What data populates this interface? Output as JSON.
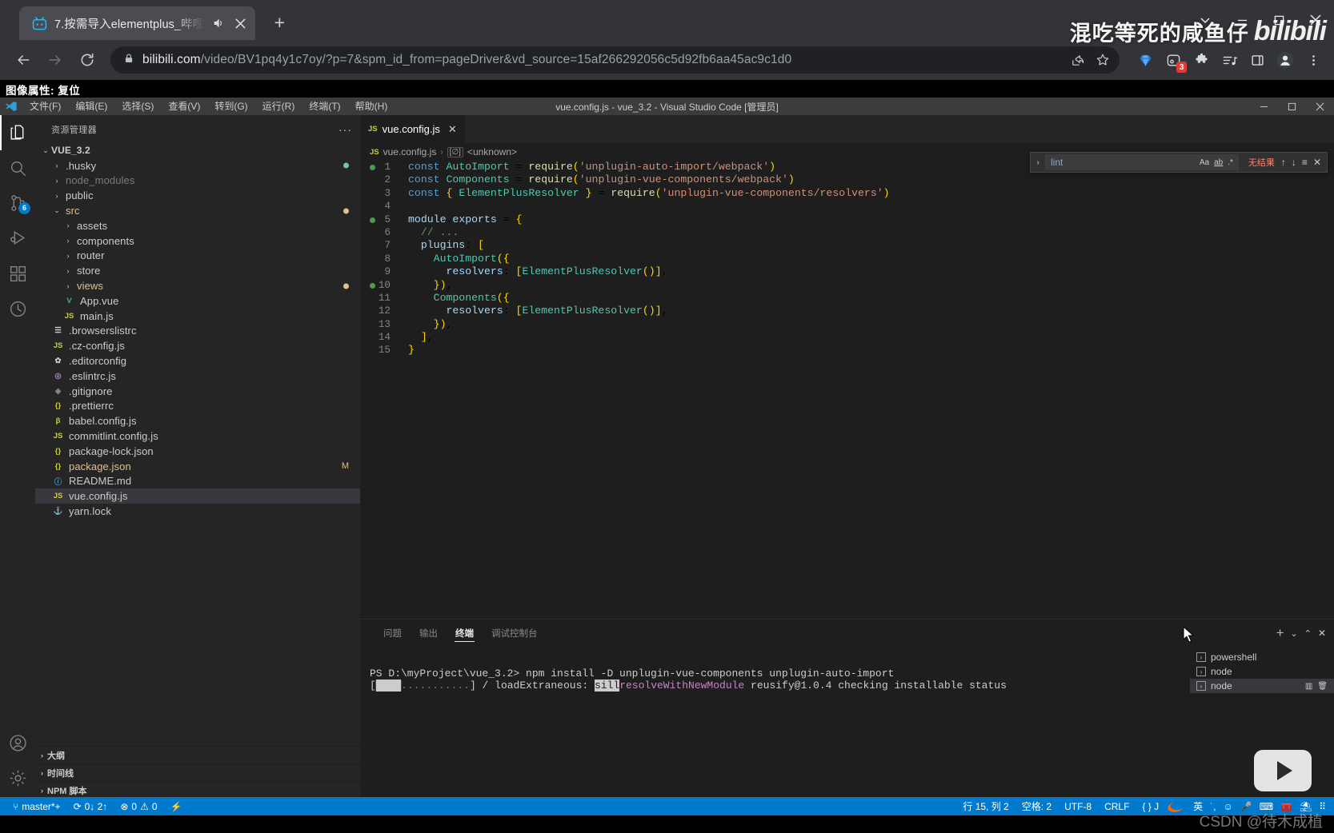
{
  "browser": {
    "tab": {
      "title": "7.按需导入elementplus_哔哩",
      "favicon": "bilibili-icon",
      "audio_icon": "speaker-icon",
      "close_icon": "close-icon"
    },
    "new_tab_label": "+",
    "window_controls": {
      "more": "⌄",
      "minimize": "—",
      "maximize": "▢",
      "close": "✕"
    },
    "nav": {
      "back": "←",
      "forward": "→",
      "reload": "⟳"
    },
    "omnibox": {
      "lock_icon": "lock-icon",
      "host": "bilibili.com",
      "path": "/video/BV1pq4y1c7oy/?p=7&spm_id_from=pageDriver&vd_source=15af266292056c5d92fb6aa45ac9c1d0",
      "share_icon": "share-icon",
      "bookmark_icon": "star-icon"
    },
    "extensions": [
      {
        "name": "diamond-extension-icon",
        "badge": ""
      },
      {
        "name": "tab-group-extension-icon",
        "badge": "3"
      },
      {
        "name": "puzzle-extensions-icon",
        "badge": ""
      },
      {
        "name": "media-playlist-icon",
        "badge": ""
      },
      {
        "name": "side-panel-icon",
        "badge": ""
      },
      {
        "name": "profile-avatar-icon",
        "badge": ""
      },
      {
        "name": "chrome-menu-icon",
        "badge": ""
      }
    ]
  },
  "capture_caption": "图像属性: 复位",
  "vscode": {
    "title": "vue.config.js - vue_3.2 - Visual Studio Code [管理员]",
    "menu": [
      "文件(F)",
      "编辑(E)",
      "选择(S)",
      "查看(V)",
      "转到(G)",
      "运行(R)",
      "终端(T)",
      "帮助(H)"
    ],
    "window_controls": {
      "minimize": "—",
      "maximize": "▢",
      "close": "✕"
    },
    "activitybar": [
      {
        "name": "explorer-icon",
        "badge": "",
        "active": true
      },
      {
        "name": "search-icon",
        "badge": "",
        "active": false
      },
      {
        "name": "source-control-icon",
        "badge": "6",
        "active": false
      },
      {
        "name": "run-debug-icon",
        "badge": "",
        "active": false
      },
      {
        "name": "extensions-icon",
        "badge": "",
        "active": false
      },
      {
        "name": "testing-icon",
        "badge": "",
        "active": false
      }
    ],
    "activitybar_bottom": [
      {
        "name": "accounts-icon"
      },
      {
        "name": "settings-gear-icon"
      }
    ],
    "sidebar": {
      "header": "资源管理器",
      "more_actions": "···",
      "root": {
        "label": "VUE_3.2",
        "expanded": true
      },
      "tree": [
        {
          "label": ".husky",
          "indent": 1,
          "type": "folder",
          "expanded": false,
          "color": "#cccccc",
          "dot": "#73c991"
        },
        {
          "label": "node_modules",
          "indent": 1,
          "type": "folder",
          "expanded": false,
          "color": "#7a7a7a",
          "dot": ""
        },
        {
          "label": "public",
          "indent": 1,
          "type": "folder",
          "expanded": false,
          "color": "#cccccc",
          "dot": ""
        },
        {
          "label": "src",
          "indent": 1,
          "type": "folder",
          "expanded": true,
          "color": "#e2c08d",
          "dot": "#e2c08d"
        },
        {
          "label": "assets",
          "indent": 2,
          "type": "folder",
          "expanded": false,
          "color": "#cccccc",
          "dot": ""
        },
        {
          "label": "components",
          "indent": 2,
          "type": "folder",
          "expanded": false,
          "color": "#cccccc",
          "dot": ""
        },
        {
          "label": "router",
          "indent": 2,
          "type": "folder",
          "expanded": false,
          "color": "#cccccc",
          "dot": ""
        },
        {
          "label": "store",
          "indent": 2,
          "type": "folder",
          "expanded": false,
          "color": "#cccccc",
          "dot": ""
        },
        {
          "label": "views",
          "indent": 2,
          "type": "folder",
          "expanded": false,
          "color": "#e2c08d",
          "dot": "#e2c08d"
        },
        {
          "label": "App.vue",
          "indent": 2,
          "type": "vue",
          "icon": "V",
          "iconColor": "#41b883",
          "color": "#cccccc",
          "dot": ""
        },
        {
          "label": "main.js",
          "indent": 2,
          "type": "js",
          "icon": "JS",
          "iconColor": "#cbcb41",
          "color": "#cccccc",
          "dot": ""
        },
        {
          "label": ".browserslistrc",
          "indent": 1,
          "type": "cfg",
          "icon": "☰",
          "iconColor": "#cccccc",
          "color": "#cccccc",
          "dot": ""
        },
        {
          "label": ".cz-config.js",
          "indent": 1,
          "type": "js",
          "icon": "JS",
          "iconColor": "#cbcb41",
          "color": "#cccccc",
          "dot": ""
        },
        {
          "label": ".editorconfig",
          "indent": 1,
          "type": "cfg",
          "icon": "✿",
          "iconColor": "#cccccc",
          "color": "#cccccc",
          "dot": ""
        },
        {
          "label": ".eslintrc.js",
          "indent": 1,
          "type": "cfg",
          "icon": "◎",
          "iconColor": "#b180d7",
          "color": "#cccccc",
          "dot": ""
        },
        {
          "label": ".gitignore",
          "indent": 1,
          "type": "cfg",
          "icon": "◈",
          "iconColor": "#8a8a8a",
          "color": "#cccccc",
          "dot": ""
        },
        {
          "label": ".prettierrc",
          "indent": 1,
          "type": "json",
          "icon": "{}",
          "iconColor": "#cbcb41",
          "color": "#cccccc",
          "dot": ""
        },
        {
          "label": "babel.config.js",
          "indent": 1,
          "type": "cfg",
          "icon": "β",
          "iconColor": "#cbcb41",
          "color": "#cccccc",
          "dot": ""
        },
        {
          "label": "commitlint.config.js",
          "indent": 1,
          "type": "js",
          "icon": "JS",
          "iconColor": "#cbcb41",
          "color": "#cccccc",
          "dot": ""
        },
        {
          "label": "package-lock.json",
          "indent": 1,
          "type": "json",
          "icon": "{}",
          "iconColor": "#cbcb41",
          "color": "#cccccc",
          "dot": ""
        },
        {
          "label": "package.json",
          "indent": 1,
          "type": "json",
          "icon": "{}",
          "iconColor": "#cbcb41",
          "color": "#e2c08d",
          "dot": "",
          "mark": "M",
          "markColor": "#e2c08d"
        },
        {
          "label": "README.md",
          "indent": 1,
          "type": "md",
          "icon": "ⓘ",
          "iconColor": "#519aba",
          "color": "#cccccc",
          "dot": ""
        },
        {
          "label": "vue.config.js",
          "indent": 1,
          "type": "js",
          "icon": "JS",
          "iconColor": "#cbcb41",
          "color": "#cccccc",
          "dot": "",
          "selected": true
        },
        {
          "label": "yarn.lock",
          "indent": 1,
          "type": "cfg",
          "icon": "⚓",
          "iconColor": "#519aba",
          "color": "#cccccc",
          "dot": ""
        }
      ],
      "sections": [
        {
          "label": "大纲",
          "expanded": false
        },
        {
          "label": "时间线",
          "expanded": false
        },
        {
          "label": "NPM 脚本",
          "expanded": false
        }
      ]
    },
    "editor": {
      "tab": {
        "label": "vue.config.js",
        "icon": "JS",
        "close": "✕"
      },
      "breadcrumbs": {
        "file": "vue.config.js",
        "separator": "›",
        "symbol_icon": "[∅]",
        "symbol": "<unknown>"
      },
      "lines": [
        {
          "n": 1,
          "text": "const AutoImport = require('unplugin-auto-import/webpack')",
          "glyph": "#4e9a4e"
        },
        {
          "n": 2,
          "text": "const Components = require('unplugin-vue-components/webpack')",
          "glyph": ""
        },
        {
          "n": 3,
          "text": "const { ElementPlusResolver } = require('unplugin-vue-components/resolvers')",
          "glyph": ""
        },
        {
          "n": 4,
          "text": "",
          "glyph": ""
        },
        {
          "n": 5,
          "text": "module.exports = {",
          "glyph": "#4e9a4e"
        },
        {
          "n": 6,
          "text": "  // ...",
          "glyph": ""
        },
        {
          "n": 7,
          "text": "  plugins: [",
          "glyph": ""
        },
        {
          "n": 8,
          "text": "    AutoImport({",
          "glyph": ""
        },
        {
          "n": 9,
          "text": "      resolvers: [ElementPlusResolver()],",
          "glyph": ""
        },
        {
          "n": 10,
          "text": "    }),",
          "glyph": "#4e9a4e"
        },
        {
          "n": 11,
          "text": "    Components({",
          "glyph": ""
        },
        {
          "n": 12,
          "text": "      resolvers: [ElementPlusResolver()],",
          "glyph": ""
        },
        {
          "n": 13,
          "text": "    }),",
          "glyph": ""
        },
        {
          "n": 14,
          "text": "  ],",
          "glyph": ""
        },
        {
          "n": 15,
          "text": "}",
          "glyph": ""
        }
      ]
    },
    "find_widget": {
      "toggle_icon": "chevron-right-icon",
      "query": "lint",
      "match_case": "Aa",
      "whole_word": "ab",
      "regex": ".*",
      "result": "无结果",
      "prev": "↑",
      "next": "↓",
      "find_in_selection": "≡",
      "close": "✕"
    },
    "panel": {
      "tabs": [
        {
          "label": "问题",
          "active": false
        },
        {
          "label": "输出",
          "active": false
        },
        {
          "label": "终端",
          "active": true
        },
        {
          "label": "调试控制台",
          "active": false
        }
      ],
      "actions": {
        "new_terminal": "+",
        "split_dropdown": "⌄",
        "maximize": "⌃",
        "close": "✕"
      },
      "terminal_lines": [
        {
          "prompt": "PS D:\\myProject\\vue_3.2>",
          "command": " npm install -D unplugin-vue-components unplugin-auto-import"
        },
        {
          "progress": "[▇▇▇▇▇...........] / loadExtraneous: ",
          "level": "sill",
          "module": "resolveWithNewModule",
          "rest": " reusify@1.0.4 checking installable status"
        }
      ],
      "terminal_list": [
        {
          "label": "powershell",
          "active": false
        },
        {
          "label": "node",
          "active": false
        },
        {
          "label": "node",
          "active": true,
          "actions": [
            "split-terminal-icon",
            "kill-terminal-icon"
          ]
        }
      ]
    },
    "statusbar": {
      "left": [
        {
          "name": "remote-branch",
          "icon": "⑂",
          "text": "master*+"
        },
        {
          "name": "sync-changes",
          "icon": "⟳",
          "text": "0↓ 2↑"
        },
        {
          "name": "problems",
          "icon": "⊗",
          "text": "0",
          "icon2": "⚠",
          "text2": "0"
        },
        {
          "name": "ports",
          "icon": "⚡",
          "text": ""
        }
      ],
      "right": [
        {
          "name": "cursor-position",
          "text": "行 15, 列 2"
        },
        {
          "name": "indentation",
          "text": "空格: 2"
        },
        {
          "name": "encoding",
          "text": "UTF-8"
        },
        {
          "name": "eol",
          "text": "CRLF"
        },
        {
          "name": "language-mode",
          "text": "{ } J"
        }
      ]
    }
  },
  "overlay": {
    "watermark_text": "混吃等死的咸鱼仔",
    "watermark_logo": "bilibili",
    "play_button": "play-icon",
    "csdn_credit": "CSDN @待木成植"
  },
  "ime": {
    "sogou_icon": "sogou-icon",
    "mode": "英",
    "items": [
      "punctuation-icon",
      "emoji-icon",
      "voice-icon",
      "keyboard-icon",
      "toolbox-icon",
      "umbrella-icon",
      "apps-icon"
    ]
  }
}
